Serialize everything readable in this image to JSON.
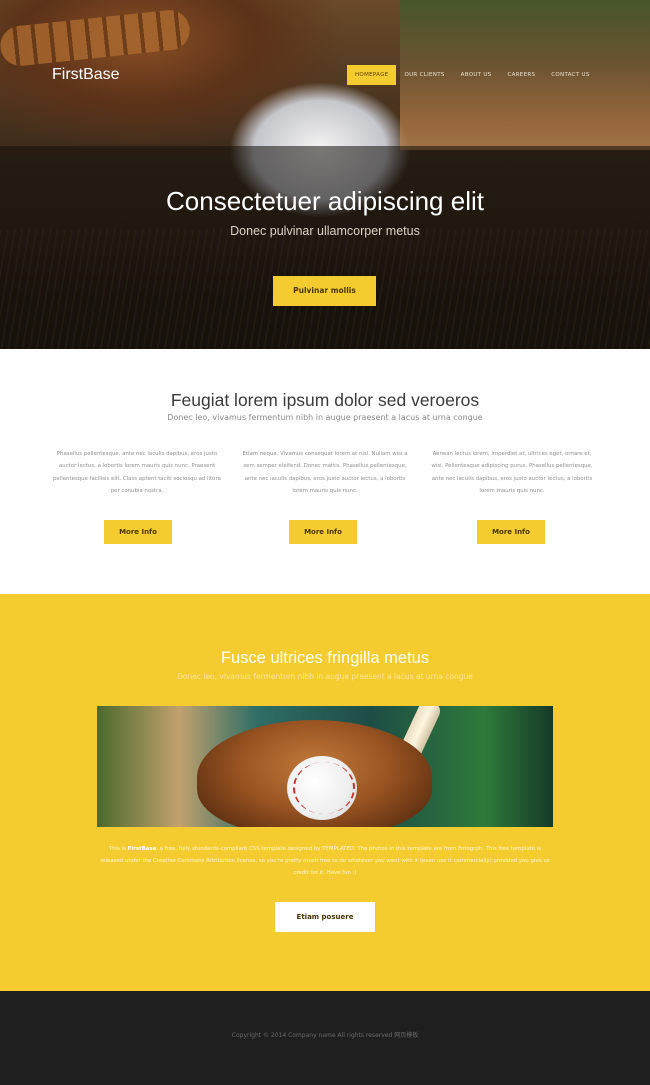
{
  "brand": {
    "logo": "FirstBase",
    "accent": "#f5cc30"
  },
  "nav": {
    "items": [
      {
        "label": "HOMEPAGE",
        "active": true
      },
      {
        "label": "OUR CLIENTS",
        "active": false
      },
      {
        "label": "ABOUT US",
        "active": false
      },
      {
        "label": "CAREERS",
        "active": false
      },
      {
        "label": "CONTACT US",
        "active": false
      }
    ]
  },
  "hero": {
    "title": "Consectetuer adipiscing elit",
    "subtitle": "Donec pulvinar ullamcorper metus",
    "button": "Pulvinar mollis"
  },
  "features": {
    "title": "Feugiat lorem ipsum dolor sed veroeros",
    "subtitle": "Donec leo, vivamus fermentum nibh in augue praesent a lacus at urna congue",
    "columns": [
      {
        "text": "Phasellus pellentesque, ante nec iaculis dapibus, eros justo auctor lectus, a lobortis lorem mauris quis nunc. Praesent pellentesque facilisis elit. Class aptent taciti sociosqu ad litora per conubia nostra.",
        "button": "More Info"
      },
      {
        "text": "Etiam neque. Vivamus consequat lorem at nisl. Nullam wisi a sem semper eleifend. Donec mattis. Phasellus pellentesque, ante nec iaculis dapibus, eros justo auctor lectus, a lobortis lorem mauris quis nunc.",
        "button": "More Info"
      },
      {
        "text": "Aenean lectus lorem, imperdiet at, ultrices eget, ornare et, wisi. Pellentesque adipiscing purus. Phasellus pellentesque, ante nec iaculis dapibus, eros justo auctor lectus, a lobortis lorem mauris quis nunc.",
        "button": "More Info"
      }
    ]
  },
  "highlight": {
    "title": "Fusce ultrices fringilla metus",
    "subtitle": "Donec leo, vivamus fermentum nibh in augue praesent a lacus at urna congue",
    "body_prefix": "This is ",
    "body_brand": "FirstBase",
    "body_rest": ", a free, fully standards-compliant CSS template designed by TEMPLATED. The photos in this template are from Fotogrph. This free template is released under the Creative Commons Attribution license, so you're pretty much free to do whatever you want with it (even use it commercially) provided you give us credit for it. Have fun :)",
    "button": "Etiam posuere"
  },
  "footer": {
    "copyright": "Copyright © 2014 Company name All rights reserved 网页模板"
  }
}
